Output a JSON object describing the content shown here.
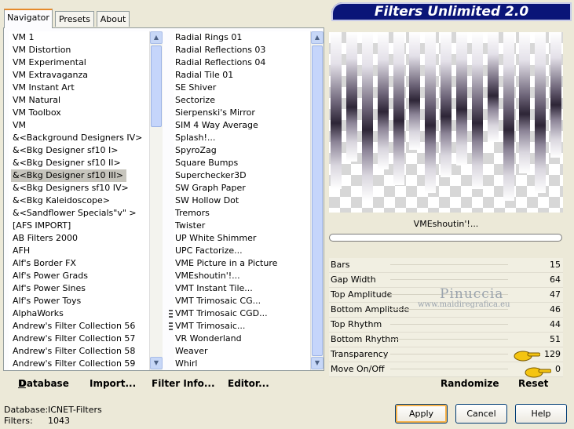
{
  "tabs": [
    "Navigator",
    "Presets",
    "About"
  ],
  "title": "Filters Unlimited 2.0",
  "categories": [
    "VM 1",
    "VM Distortion",
    "VM Experimental",
    "VM Extravaganza",
    "VM Instant Art",
    "VM Natural",
    "VM Toolbox",
    "VM",
    "&<Background Designers IV>",
    "&<Bkg Designer sf10 I>",
    "&<Bkg Designer sf10 II>",
    "&<Bkg Designer sf10 III>",
    "&<Bkg Designers sf10 IV>",
    "&<Bkg Kaleidoscope>",
    "&<Sandflower Specials\"v\" >",
    "[AFS IMPORT]",
    "AB Filters 2000",
    "AFH",
    "Alf's Border FX",
    "Alf's Power Grads",
    "Alf's Power Sines",
    "Alf's Power Toys",
    "AlphaWorks",
    "Andrew's Filter Collection 56",
    "Andrew's Filter Collection 57",
    "Andrew's Filter Collection 58",
    "Andrew's Filter Collection 59"
  ],
  "selected_category": "&<Bkg Designer sf10 III>",
  "filters": [
    "Radial  Rings 01",
    "Radial Reflections 03",
    "Radial Reflections 04",
    "Radial Tile 01",
    "SE Shiver",
    "Sectorize",
    "Sierpenski's Mirror",
    "SIM 4 Way Average",
    "Splash!...",
    "SpyroZag",
    "Square Bumps",
    "Superchecker3D",
    "SW Graph Paper",
    "SW Hollow Dot",
    "Tremors",
    "Twister",
    "UP White Shimmer",
    "UPC Factorize...",
    "VME Picture in a Picture",
    "VMEshoutin'!...",
    "VMT Instant Tile...",
    "VMT Trimosaic CG...",
    "VMT Trimosaic CGD...",
    "VMT Trimosaic...",
    "VR Wonderland",
    "Weaver",
    "Whirl"
  ],
  "selected_filter": "VMEshoutin'!...",
  "preview_label": "VMEshoutin'!...",
  "params": [
    {
      "label": "Bars",
      "value": "15"
    },
    {
      "label": "Gap Width",
      "value": "64"
    },
    {
      "label": "Top Amplitude",
      "value": "47"
    },
    {
      "label": "Bottom Amplitude",
      "value": "46"
    },
    {
      "label": "Top Rhythm",
      "value": "44"
    },
    {
      "label": "Bottom Rhythm",
      "value": "51"
    },
    {
      "label": "Transparency",
      "value": "129"
    },
    {
      "label": "Move On/Off",
      "value": "0"
    }
  ],
  "watermark": {
    "line1": "Pinuccia",
    "line2": "www.maidiregrafica.eu"
  },
  "bottom_left": {
    "database": "Database",
    "import": "Import...",
    "filter_info": "Filter Info...",
    "editor": "Editor..."
  },
  "bottom_right": {
    "randomize": "Randomize",
    "reset": "Reset"
  },
  "status": {
    "db_label": "Database:",
    "db_value": "ICNET-Filters",
    "filters_label": "Filters:",
    "filters_value": "1043"
  },
  "buttons": {
    "apply": "Apply",
    "cancel": "Cancel",
    "help": "Help"
  }
}
